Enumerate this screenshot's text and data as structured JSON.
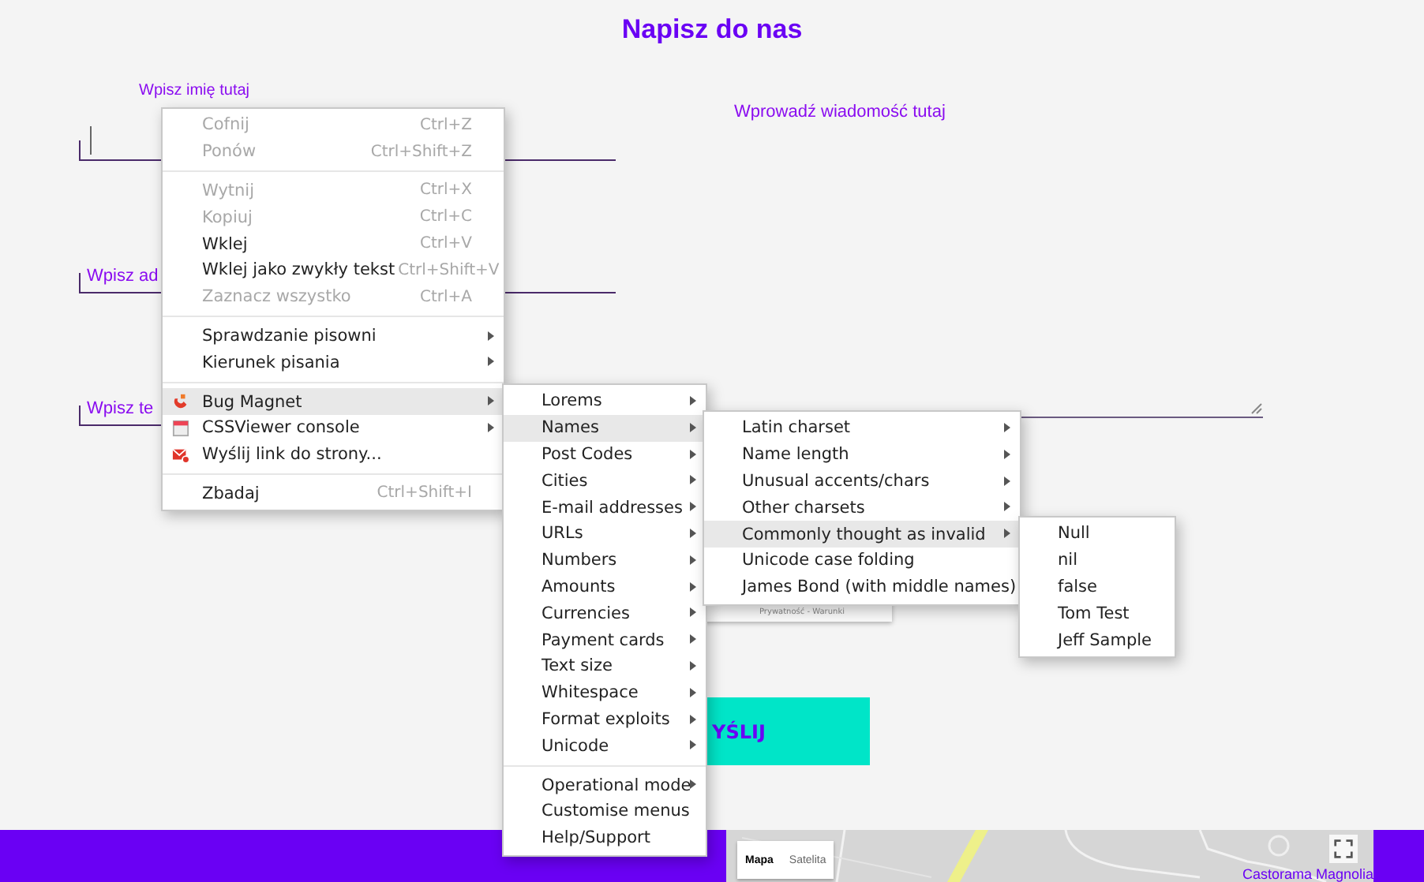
{
  "title": "Napisz do nas",
  "form": {
    "fields": [
      {
        "placeholder": "Wpisz imię tutaj",
        "floating": true
      },
      {
        "placeholder": "Wpisz ad",
        "floating": false
      },
      {
        "placeholder": "Wpisz te",
        "floating": false
      }
    ],
    "message": {
      "placeholder": "Wprowadź wiadomość tutaj"
    },
    "captcha_footer": "Prywatność - Warunki",
    "send_button": "YŚLIJ"
  },
  "map": {
    "buttons": [
      {
        "label": "Mapa",
        "selected": true
      },
      {
        "label": "Satelita",
        "selected": false
      }
    ],
    "place_label": "Castorama Magnolia"
  },
  "context_menu": {
    "groups": [
      [
        {
          "label": "Cofnij",
          "shortcut": "Ctrl+Z",
          "disabled": true,
          "submenu": false,
          "selected": false
        },
        {
          "label": "Ponów",
          "shortcut": "Ctrl+Shift+Z",
          "disabled": true,
          "submenu": false,
          "selected": false
        }
      ],
      [
        {
          "label": "Wytnij",
          "shortcut": "Ctrl+X",
          "disabled": true,
          "submenu": false,
          "selected": false
        },
        {
          "label": "Kopiuj",
          "shortcut": "Ctrl+C",
          "disabled": true,
          "submenu": false,
          "selected": false
        },
        {
          "label": "Wklej",
          "shortcut": "Ctrl+V",
          "disabled": false,
          "submenu": false,
          "selected": false
        },
        {
          "label": "Wklej jako zwykły tekst",
          "shortcut": "Ctrl+Shift+V",
          "disabled": false,
          "submenu": false,
          "selected": false
        },
        {
          "label": "Zaznacz wszystko",
          "shortcut": "Ctrl+A",
          "disabled": true,
          "submenu": false,
          "selected": false
        }
      ],
      [
        {
          "label": "Sprawdzanie pisowni",
          "disabled": false,
          "submenu": true,
          "selected": false
        },
        {
          "label": "Kierunek pisania",
          "disabled": false,
          "submenu": true,
          "selected": false
        }
      ],
      [
        {
          "label": "Bug Magnet",
          "disabled": false,
          "submenu": true,
          "selected": true
        },
        {
          "label": "CSSViewer console",
          "disabled": false,
          "submenu": true,
          "selected": false
        },
        {
          "label": "Wyślij link do strony...",
          "disabled": false,
          "submenu": false,
          "selected": false
        }
      ],
      [
        {
          "label": "Zbadaj",
          "shortcut": "Ctrl+Shift+I",
          "disabled": false,
          "submenu": false,
          "selected": false
        }
      ]
    ]
  },
  "bug_magnet_menu": {
    "groups": [
      [
        {
          "label": "Lorems",
          "submenu": true,
          "selected": false
        },
        {
          "label": "Names",
          "submenu": true,
          "selected": true
        },
        {
          "label": "Post Codes",
          "submenu": true,
          "selected": false
        },
        {
          "label": "Cities",
          "submenu": true,
          "selected": false
        },
        {
          "label": "E-mail addresses",
          "submenu": true,
          "selected": false
        },
        {
          "label": "URLs",
          "submenu": true,
          "selected": false
        },
        {
          "label": "Numbers",
          "submenu": true,
          "selected": false
        },
        {
          "label": "Amounts",
          "submenu": true,
          "selected": false
        },
        {
          "label": "Currencies",
          "submenu": true,
          "selected": false
        },
        {
          "label": "Payment cards",
          "submenu": true,
          "selected": false
        },
        {
          "label": "Text size",
          "submenu": true,
          "selected": false
        },
        {
          "label": "Whitespace",
          "submenu": true,
          "selected": false
        },
        {
          "label": "Format exploits",
          "submenu": true,
          "selected": false
        },
        {
          "label": "Unicode",
          "submenu": true,
          "selected": false
        }
      ],
      [
        {
          "label": "Operational mode",
          "submenu": true,
          "selected": false
        },
        {
          "label": "Customise menus",
          "submenu": false,
          "selected": false
        },
        {
          "label": "Help/Support",
          "submenu": false,
          "selected": false
        }
      ]
    ]
  },
  "names_menu": {
    "groups": [
      [
        {
          "label": "Latin charset",
          "submenu": true,
          "selected": false
        },
        {
          "label": "Name length",
          "submenu": true,
          "selected": false
        },
        {
          "label": "Unusual accents/chars",
          "submenu": true,
          "selected": false
        },
        {
          "label": "Other charsets",
          "submenu": true,
          "selected": false
        },
        {
          "label": "Commonly thought as invalid",
          "submenu": true,
          "selected": true
        },
        {
          "label": "Unicode case folding",
          "submenu": false,
          "selected": false
        },
        {
          "label": "James Bond (with middle names)",
          "submenu": false,
          "selected": false
        }
      ]
    ]
  },
  "invalid_names_menu": {
    "groups": [
      [
        {
          "label": "Null",
          "submenu": false,
          "selected": false
        },
        {
          "label": "nil",
          "submenu": false,
          "selected": false
        },
        {
          "label": "false",
          "submenu": false,
          "selected": false
        },
        {
          "label": "Tom Test",
          "submenu": false,
          "selected": false
        },
        {
          "label": "Jeff Sample",
          "submenu": false,
          "selected": false
        }
      ]
    ]
  }
}
